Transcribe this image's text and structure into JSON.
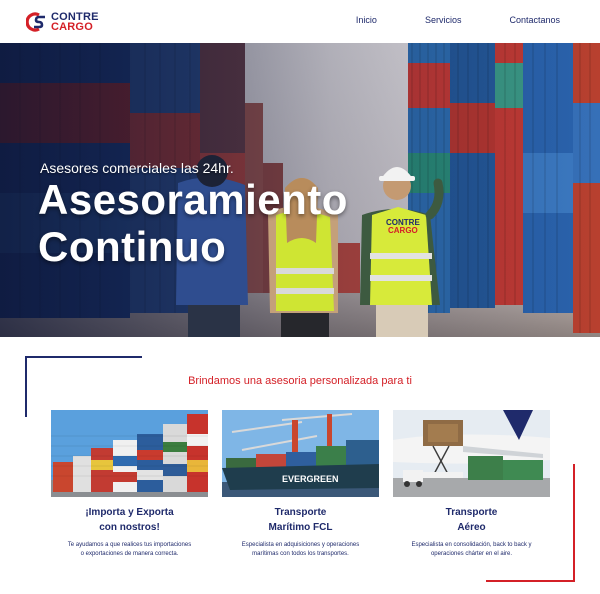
{
  "brand": {
    "name_line1": "CONTRE",
    "name_line2": "CARGO",
    "navy": "#1f2a6b",
    "red": "#d42027",
    "logo_icon": "cs-logo-icon"
  },
  "nav": {
    "items": [
      "Inicio",
      "Servicios",
      "Contactanos"
    ]
  },
  "hero": {
    "subtitle": "Asesores comerciales las 24hr.",
    "title_line1": "Asesoramiento",
    "title_line2": "Continuo"
  },
  "services": {
    "tagline": "Brindamos una asesoria personalizada para ti",
    "cards": [
      {
        "title_line1": "¡Importa y Exporta",
        "title_line2": "con nostros!",
        "desc_line1": "Te ayudamos a que realices tus importaciones",
        "desc_line2": "o exportaciones de manera correcta."
      },
      {
        "title_line1": "Transporte",
        "title_line2": "Marítimo FCL",
        "desc_line1": "Especialista en adquisiciones y operaciones",
        "desc_line2": "marítimas con todos los transportes.",
        "ship_name": "EVERGREEN"
      },
      {
        "title_line1": "Transporte",
        "title_line2": "Aéreo",
        "desc_line1": "Especialista en consolidación, back to back y",
        "desc_line2": "operaciones chárter en el aire."
      }
    ]
  },
  "vest_text_line1": "CONTRE",
  "vest_text_line2": "CARGO"
}
